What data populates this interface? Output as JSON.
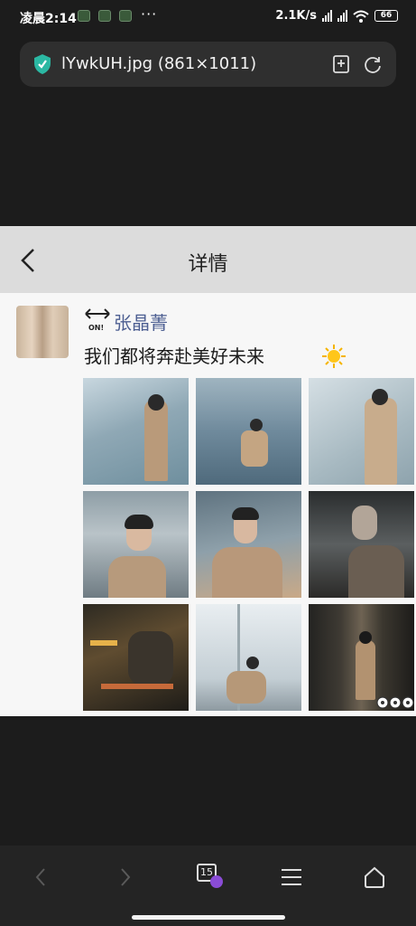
{
  "status_bar": {
    "time": "凌晨2:14",
    "dots": "···",
    "network_speed": "2.1K/s",
    "battery": "66"
  },
  "address_bar": {
    "title": "lYwkUH.jpg (861×1011)"
  },
  "detail_page": {
    "header_title": "详情",
    "post": {
      "badge_text": "ON!",
      "username": "张晶菁",
      "text": "我们都将奔赴美好未来"
    }
  },
  "bottom_nav": {
    "tab_count": "15"
  },
  "colors": {
    "username": "#4d5f92",
    "tabs_badge": "#8a4cd6",
    "shield": "#2bb8a3"
  }
}
